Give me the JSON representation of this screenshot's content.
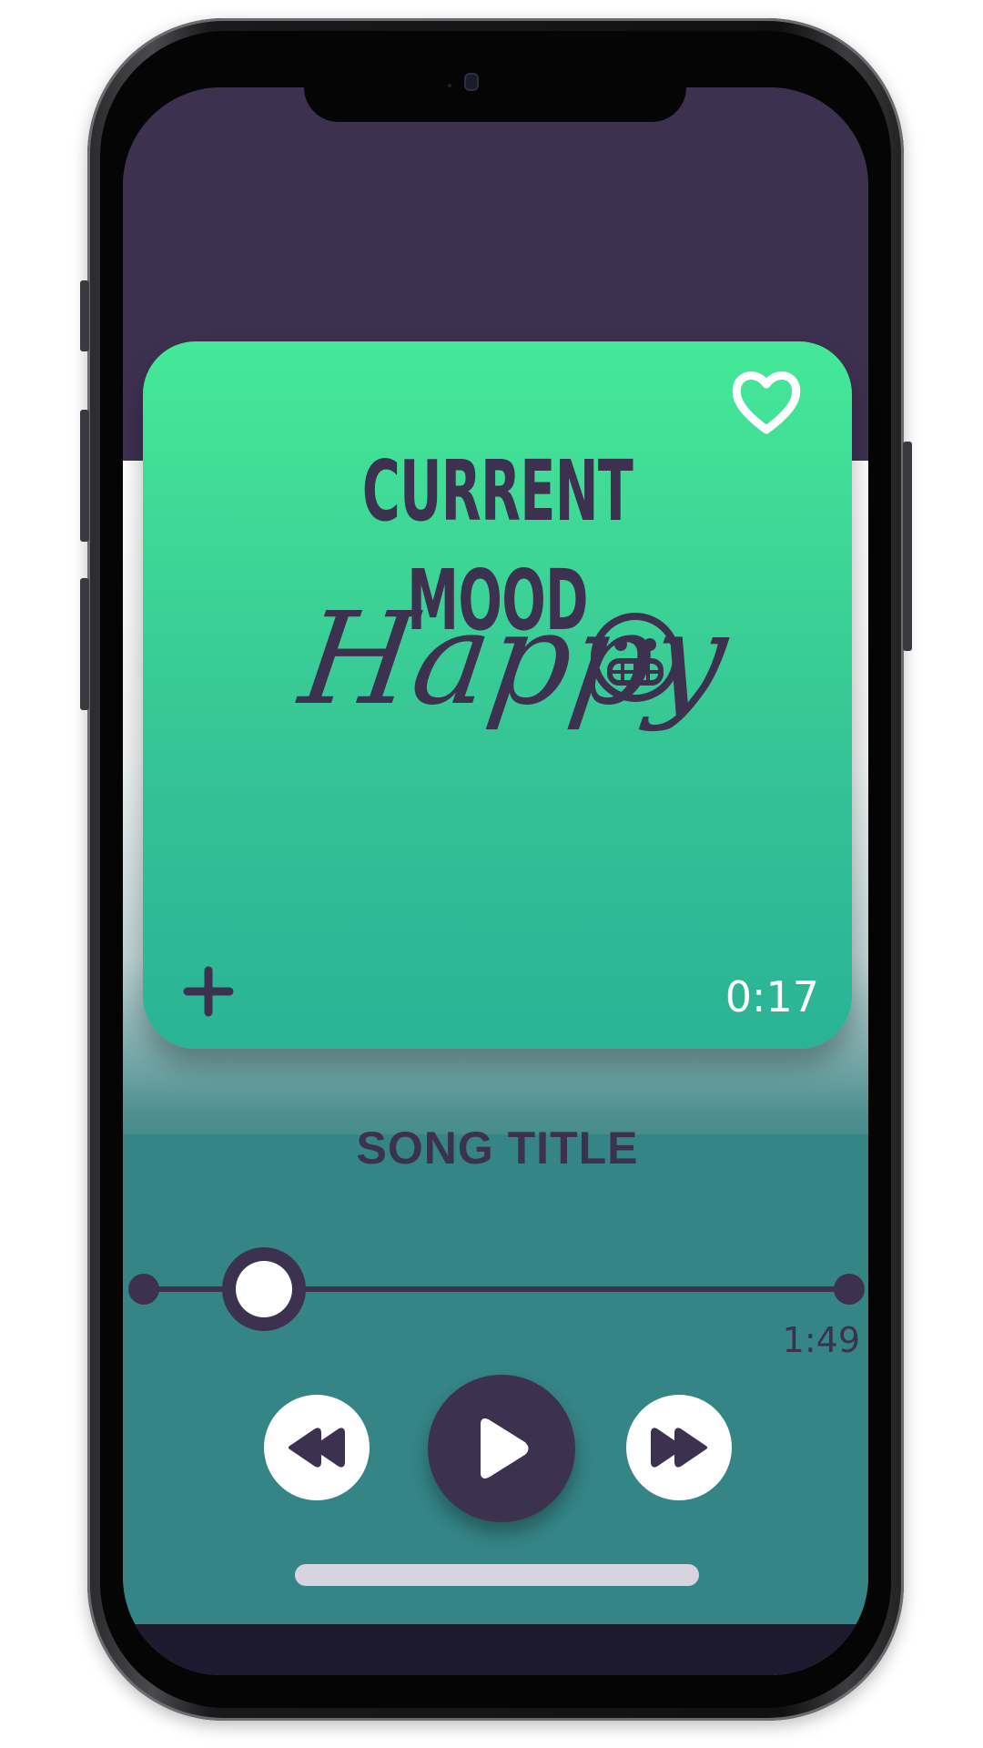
{
  "app": {
    "name": "mood-music-player"
  },
  "colors": {
    "primary_dark": "#3d3150",
    "mint_top": "#45e898",
    "mint_bottom": "#2ab396",
    "teal_bg": "#358486",
    "white": "#ffffff"
  },
  "mood_card": {
    "heading": "CURRENT MOOD",
    "mood": "Happy",
    "mood_emoji_icon": "grinning-face-icon",
    "favorite_icon": "heart-outline-icon",
    "add_icon": "plus-icon",
    "elapsed_time": "0:17"
  },
  "player": {
    "song_title": "SONG TITLE",
    "total_time": "1:49",
    "progress_fraction": 0.17,
    "controls": {
      "rewind_icon": "rewind-icon",
      "play_icon": "play-icon",
      "fast_forward_icon": "fast-forward-icon"
    }
  }
}
